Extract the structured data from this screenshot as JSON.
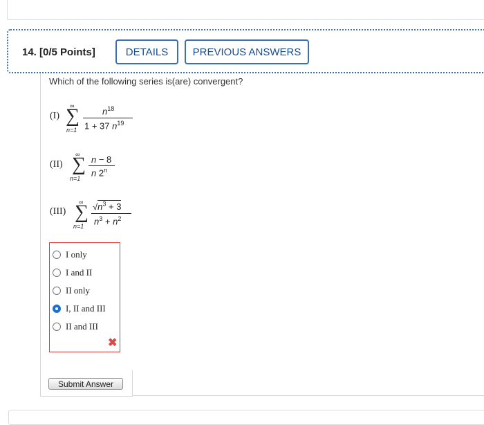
{
  "question": {
    "number": "14.",
    "points": "[0/5 Points]",
    "details_label": "DETAILS",
    "previous_answers_label": "PREVIOUS ANSWERS",
    "prompt": "Which of the following series is(are) convergent?"
  },
  "series": [
    {
      "label": "(I)",
      "upper": "∞",
      "lower": "n=1",
      "numerator": "n18",
      "denominator": "1 + 37 n19"
    },
    {
      "label": "(II)",
      "upper": "∞",
      "lower": "n=1",
      "numerator": "n − 8",
      "denominator": "n 2n"
    },
    {
      "label": "(III)",
      "upper": "∞",
      "lower": "n=1",
      "numerator": "√(n3 + 3)",
      "denominator": "n3 + n2"
    }
  ],
  "choices": [
    {
      "label": "I only",
      "selected": false
    },
    {
      "label": "I and II",
      "selected": false
    },
    {
      "label": "II only",
      "selected": false
    },
    {
      "label": "I, II and III",
      "selected": true
    },
    {
      "label": "II and III",
      "selected": false
    }
  ],
  "result_icon": "x-mark-icon",
  "submit_label": "Submit Answer",
  "colors": {
    "accent": "#3a6fb0",
    "error": "#e23b3b",
    "selected": "#1f6fd0"
  }
}
